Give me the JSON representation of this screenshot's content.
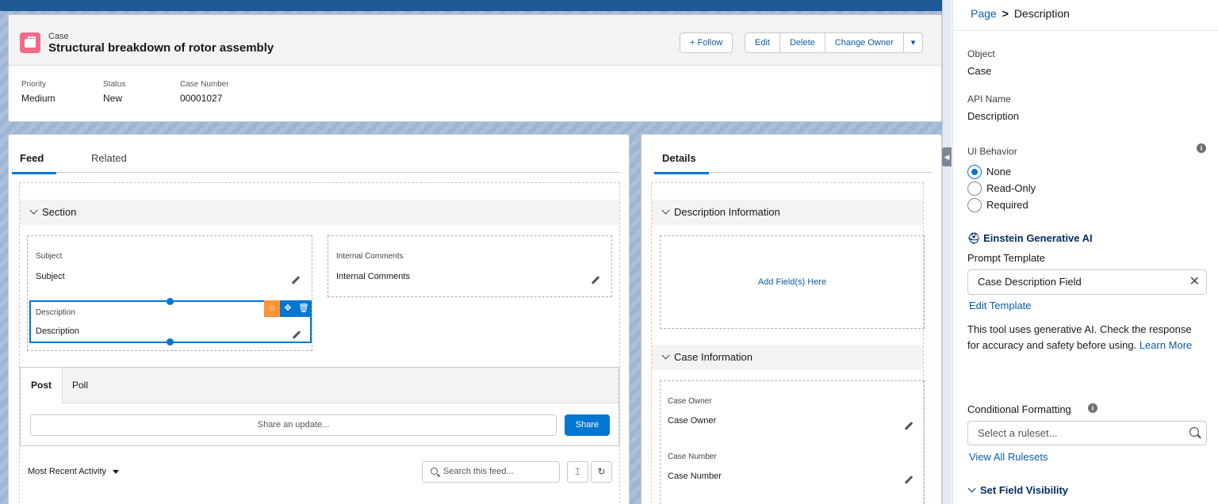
{
  "header": {
    "object_label": "Case",
    "title": "Structural breakdown of rotor assembly",
    "actions": {
      "follow": "+ Follow",
      "edit": "Edit",
      "delete": "Delete",
      "change_owner": "Change Owner",
      "more": "▾"
    },
    "highlights": [
      {
        "label": "Priority",
        "value": "Medium"
      },
      {
        "label": "Status",
        "value": "New"
      },
      {
        "label": "Case Number",
        "value": "00001027"
      }
    ]
  },
  "main": {
    "tabs": [
      "Feed",
      "Related"
    ],
    "section_title": "Section",
    "fields": {
      "subject": {
        "label": "Subject",
        "value": "Subject"
      },
      "internal_comments": {
        "label": "Internal Comments",
        "value": "Internal Comments"
      },
      "description": {
        "label": "Description",
        "value": "Description"
      }
    },
    "publisher": {
      "tabs": [
        "Post",
        "Poll"
      ],
      "placeholder": "Share an update...",
      "share_label": "Share"
    },
    "feed": {
      "sort_label": "Most Recent Activity",
      "search_placeholder": "Search this feed..."
    }
  },
  "details": {
    "tab": "Details",
    "sections": [
      {
        "title": "Description Information",
        "empty_text": "Add Field(s) Here"
      },
      {
        "title": "Case Information"
      }
    ],
    "fields": [
      {
        "label": "Case Owner",
        "value": "Case Owner"
      },
      {
        "label": "Case Number",
        "value": "Case Number"
      }
    ]
  },
  "panel": {
    "breadcrumb": {
      "parent": "Page",
      "separator": ">",
      "current": "Description"
    },
    "object_label": "Object",
    "object_value": "Case",
    "api_name_label": "API Name",
    "api_name_value": "Description",
    "ui_behavior_label": "UI Behavior",
    "ui_behavior_options": [
      "None",
      "Read-Only",
      "Required"
    ],
    "ui_behavior_selected": "None",
    "einstein_title": "Einstein Generative AI",
    "prompt_template_label": "Prompt Template",
    "prompt_template_value": "Case Description Field",
    "edit_template": "Edit Template",
    "disclaimer": "This tool uses generative AI. Check the response for accuracy and safety before using.",
    "learn_more": "Learn More",
    "conditional_formatting_label": "Conditional Formatting",
    "ruleset_placeholder": "Select a ruleset...",
    "view_rulesets": "View All Rulesets",
    "set_field_visibility": "Set Field Visibility"
  },
  "colors": {
    "brand_blue": "#0176d3",
    "case_pink": "#f2698a",
    "einstein_orange": "#fe9339",
    "canvas_blue": "#a9bfda"
  }
}
